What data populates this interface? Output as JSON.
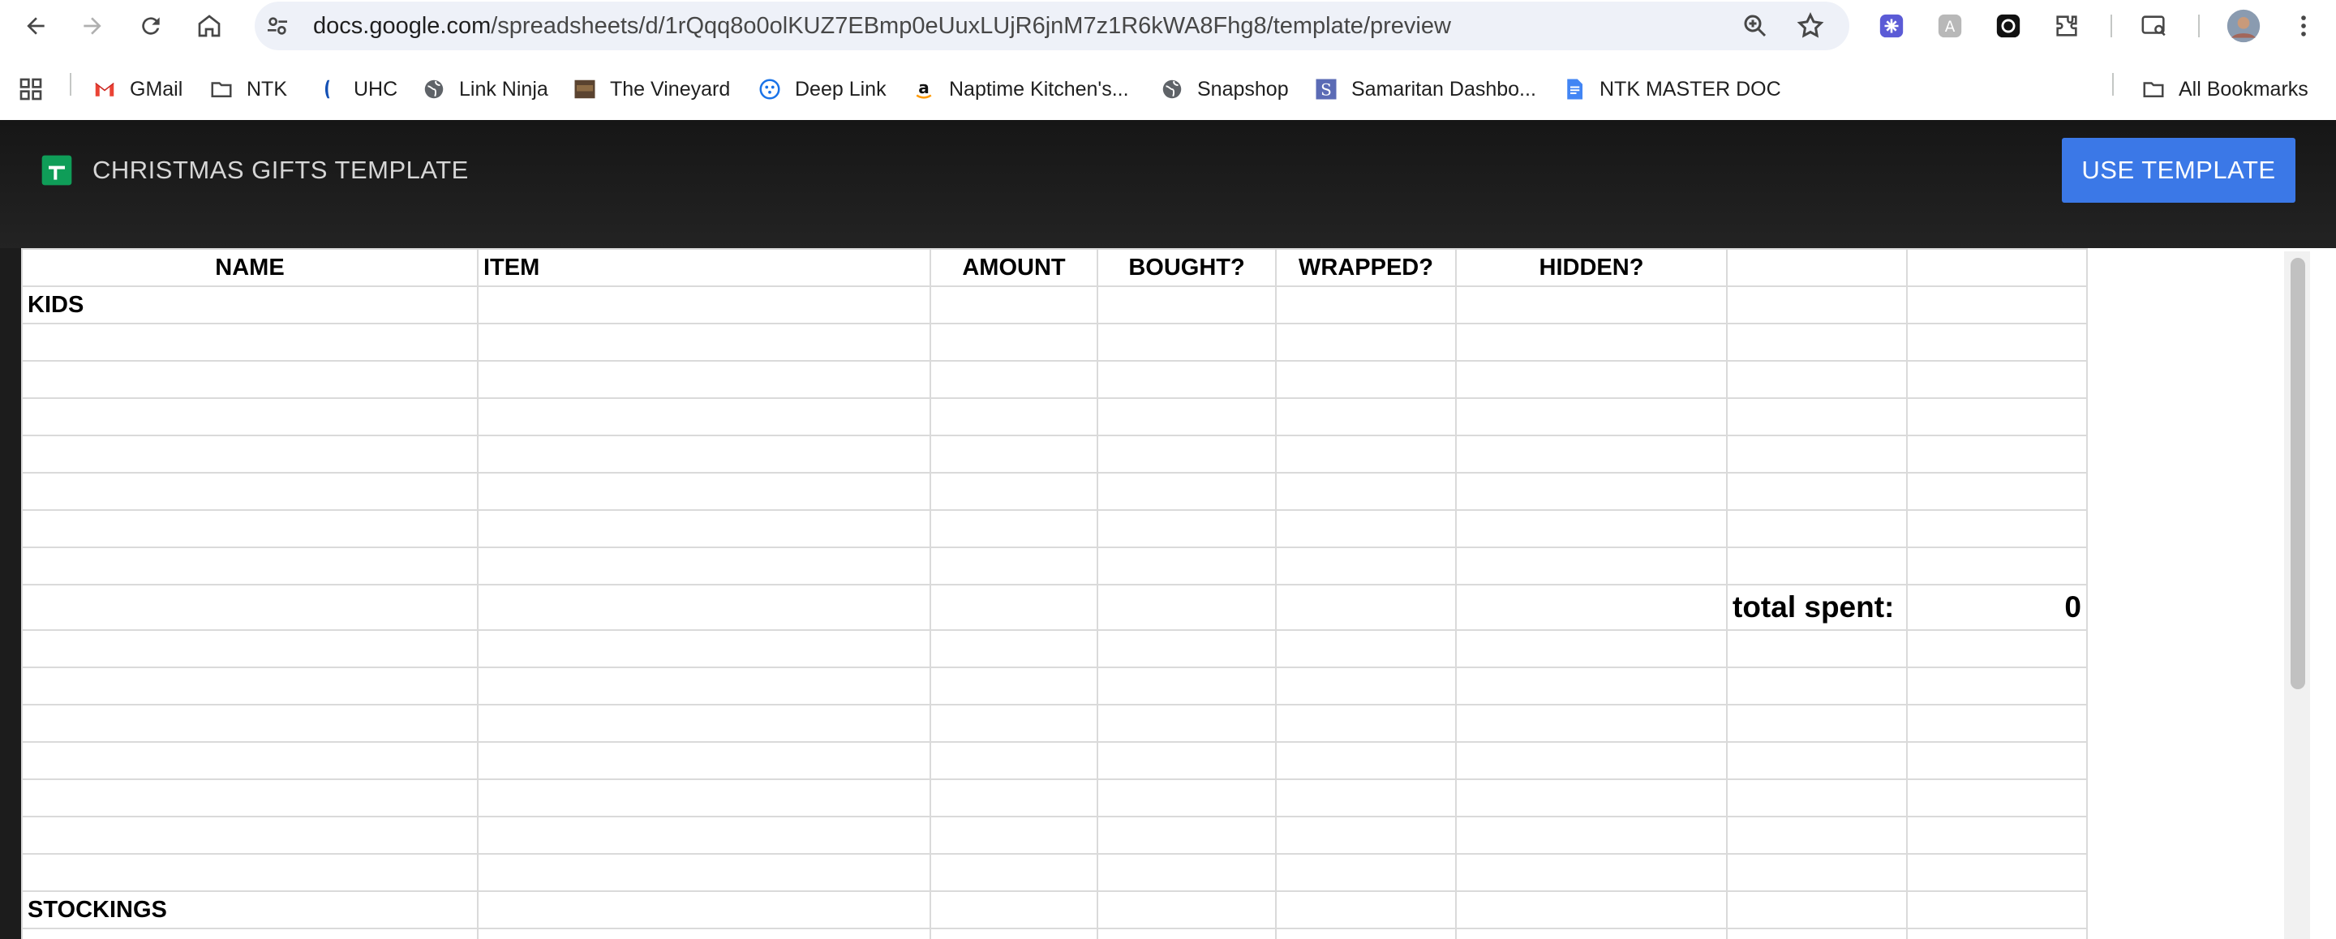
{
  "browser": {
    "url_host": "docs.google.com",
    "url_path": "/spreadsheets/d/1rQqq8o0olKUZ7EBmp0eUuxLUjR6jnM7z1R6kWA8Fhg8/template/preview"
  },
  "bookmarks": {
    "items": [
      {
        "label": "GMail",
        "icon": "gmail-icon"
      },
      {
        "label": "NTK",
        "icon": "folder-icon"
      },
      {
        "label": "UHC",
        "icon": "uhc-icon"
      },
      {
        "label": "Link Ninja",
        "icon": "globe-icon"
      },
      {
        "label": "The Vineyard",
        "icon": "vineyard-icon"
      },
      {
        "label": "Deep Link",
        "icon": "deep-link-icon"
      },
      {
        "label": "Naptime Kitchen's...",
        "icon": "amazon-icon"
      },
      {
        "label": "Snapshop",
        "icon": "globe-icon"
      },
      {
        "label": "Samaritan Dashbo...",
        "icon": "samaritan-icon"
      },
      {
        "label": "NTK MASTER DOC",
        "icon": "docs-icon"
      }
    ],
    "all_bookmarks": "All Bookmarks"
  },
  "template": {
    "title": "CHRISTMAS GIFTS TEMPLATE",
    "use_button": "USE TEMPLATE"
  },
  "sheet": {
    "headers": [
      "NAME",
      "ITEM",
      "AMOUNT",
      "BOUGHT?",
      "WRAPPED?",
      "HIDDEN?",
      "",
      ""
    ],
    "section_kids": "KIDS",
    "total_label": "total spent:",
    "total_value": "0",
    "section_stockings": "STOCKINGS"
  },
  "colors": {
    "header_bg": "#1b1b1b",
    "use_button": "#3b78e7",
    "sheets_green": "#0f9d58"
  }
}
